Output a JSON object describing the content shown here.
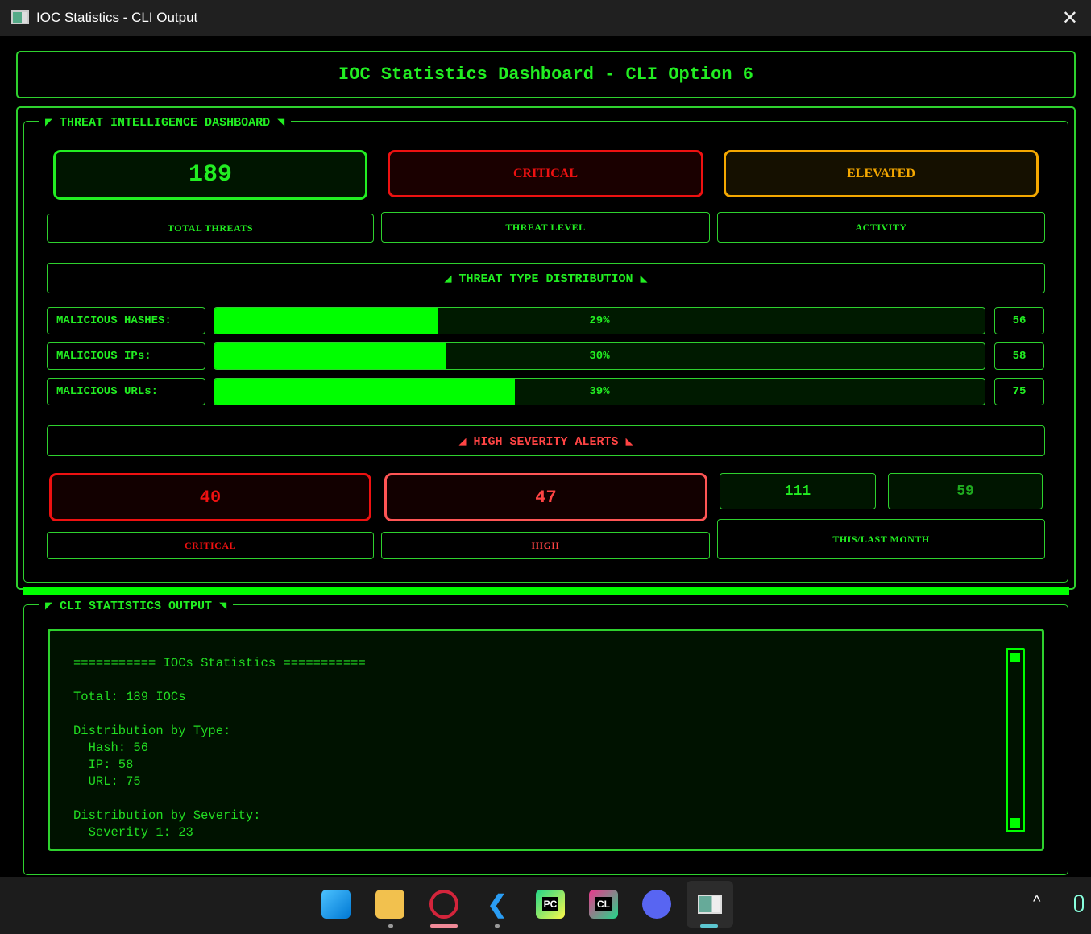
{
  "window": {
    "title": "IOC Statistics - CLI Output",
    "close": "✕"
  },
  "header": {
    "title": "IOC Statistics Dashboard - CLI Option 6"
  },
  "dashboard": {
    "legend": "◤ THREAT INTELLIGENCE DASHBOARD ◥",
    "total": {
      "value": "189",
      "label": "TOTAL THREATS"
    },
    "level": {
      "value": "CRITICAL",
      "label": "THREAT LEVEL"
    },
    "activity": {
      "value": "ELEVATED",
      "label": "ACTIVITY"
    },
    "distribution_title": "◢ THREAT TYPE DISTRIBUTION ◣",
    "distribution": [
      {
        "label": "MALICIOUS HASHES:",
        "percent": 29,
        "percent_text": "29%",
        "count": "56"
      },
      {
        "label": "MALICIOUS IPs:",
        "percent": 30,
        "percent_text": "30%",
        "count": "58"
      },
      {
        "label": "MALICIOUS URLs:",
        "percent": 39,
        "percent_text": "39%",
        "count": "75"
      }
    ],
    "alerts_title": "◢ HIGH SEVERITY ALERTS ◣",
    "critical": {
      "value": "40",
      "label": "CRITICAL"
    },
    "high": {
      "value": "47",
      "label": "HIGH"
    },
    "this_month": "111",
    "last_month": "59",
    "month_label": "THIS/LAST MONTH"
  },
  "cli": {
    "legend": "◤ CLI STATISTICS OUTPUT ◥",
    "output": "=========== IOCs Statistics ===========\n\nTotal: 189 IOCs\n\nDistribution by Type:\n  Hash: 56\n  IP: 58\n  URL: 75\n\nDistribution by Severity:\n  Severity 1: 23"
  },
  "taskbar": {
    "apps": [
      "start",
      "file-explorer",
      "opera",
      "vscode",
      "pycharm",
      "clion",
      "discord",
      "ioc-statistics"
    ],
    "pc": "PC",
    "cl": "CL",
    "chevron": "^"
  }
}
